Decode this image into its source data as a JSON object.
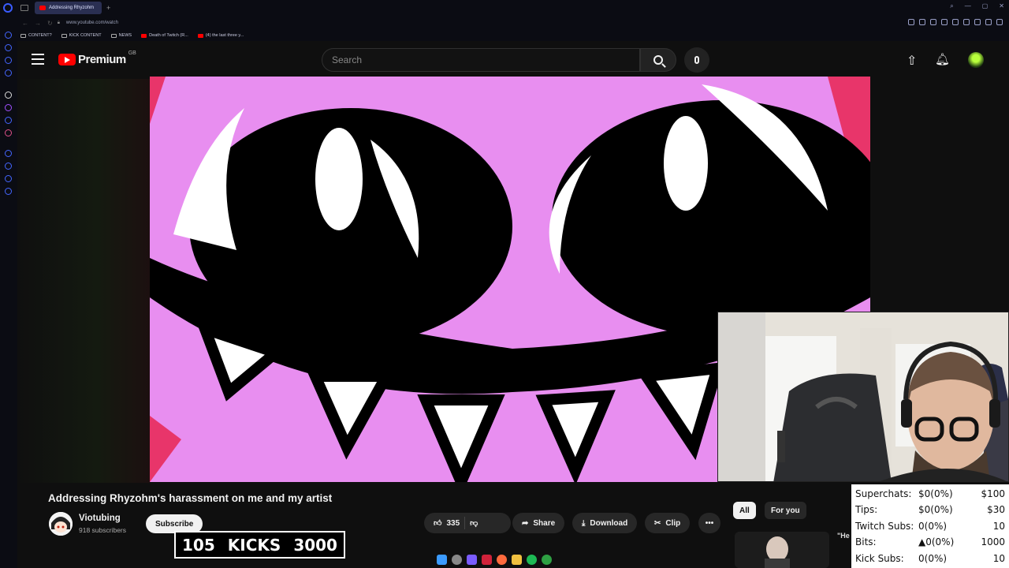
{
  "browser": {
    "tab_title": "Addressing Rhyzohm",
    "url": "www.youtube.com/watch",
    "bookmarks": [
      "CONTENT?",
      "KICK CONTENT",
      "NEWS",
      "Death of Twitch (R...",
      "(4) the last three y..."
    ]
  },
  "masthead": {
    "logo_text": "Premium",
    "region": "GB",
    "search_placeholder": "Search"
  },
  "video": {
    "title": "Addressing Rhyzohm's harassment on me and my artist",
    "channel_name": "Viotubing",
    "subscribers": "918 subscribers",
    "subscribe_label": "Subscribe",
    "like_count": "335",
    "share_label": "Share",
    "download_label": "Download",
    "clip_label": "Clip"
  },
  "sidebar_chips": {
    "all": "All",
    "for_you": "For you"
  },
  "recommendation": {
    "snippet": "\"He"
  },
  "kicks_overlay": {
    "left": "105",
    "label": "KICKS",
    "right": "3000"
  },
  "stats_overlay": {
    "rows": [
      {
        "label": "Superchats:",
        "value": "$0(0%)",
        "goal": "$100"
      },
      {
        "label": "Tips:",
        "value": "$0(0%)",
        "goal": "$30"
      },
      {
        "label": "Twitch Subs:",
        "value": "0(0%)",
        "goal": "10"
      },
      {
        "label": "Bits:",
        "value": "0(0%)",
        "goal": "1000"
      },
      {
        "label": "Kick Subs:",
        "value": "0(0%)",
        "goal": "10"
      }
    ]
  },
  "colors": {
    "yt_red": "#ff0000",
    "video_pink": "#e88ef0",
    "background": "#0f0f0f"
  }
}
